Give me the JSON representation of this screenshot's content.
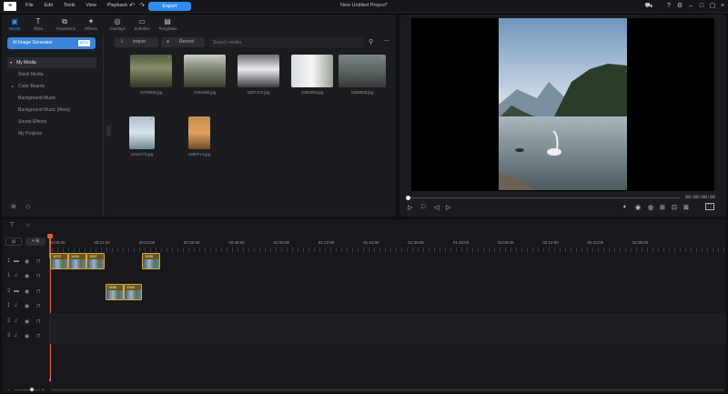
{
  "app": {
    "logo": "≡",
    "menu": [
      "File",
      "Edit",
      "Tools",
      "View",
      "Playback"
    ],
    "undo": "↶",
    "redo": "↷",
    "export_label": "Export",
    "project_title": "New Untitled Project*"
  },
  "top_tabs": [
    {
      "label": "Media",
      "glyph": "▣"
    },
    {
      "label": "Titles",
      "glyph": "T"
    },
    {
      "label": "Transitions",
      "glyph": "⧉"
    },
    {
      "label": "Effects",
      "glyph": "✦"
    },
    {
      "label": "Overlays",
      "glyph": "◎"
    },
    {
      "label": "Subtitles",
      "glyph": "▭"
    },
    {
      "label": "Templates",
      "glyph": "▤"
    }
  ],
  "sidebar": {
    "ai_label": "AI Image Generator",
    "ai_badge": "BETA",
    "items": [
      "My Media",
      "Stock Media",
      "Color Boards",
      "Background Music",
      "Background Music (Meta)",
      "Sound Effects",
      "My Projects"
    ]
  },
  "media_toolbar": {
    "import": "Import",
    "record": "Record",
    "search_placeholder": "Search media"
  },
  "media_files": [
    "1078488.jpg",
    "1494495.jpg",
    "1507472.jpg",
    "1930492.jpg",
    "1936828.jpg",
    "1264270.jpg",
    "1680714.jpg"
  ],
  "preview": {
    "time": "00:00:00:00"
  },
  "timeline": {
    "ruler": [
      "00:00:00",
      "00:12:00",
      "00:24:00",
      "00:36:00",
      "00:48:00",
      "01:00:00",
      "01:12:00",
      "01:24:00",
      "01:36:00",
      "01:48:00",
      "02:00:00",
      "02:12:00",
      "02:24:00",
      "02:36:00"
    ],
    "tracks": [
      "1",
      "1",
      "2",
      "1",
      "2",
      "3"
    ],
    "clips": [
      {
        "label": "1072"
      },
      {
        "label": "1494"
      },
      {
        "label": "1507"
      },
      {
        "label": "1930"
      },
      {
        "label": "1936"
      },
      {
        "label": "1264"
      }
    ]
  },
  "colors": {
    "accent": "#2f8cf0",
    "panel": "#1b1c20",
    "clip": "#d6aa3c",
    "playhead": "#e05a3a"
  }
}
